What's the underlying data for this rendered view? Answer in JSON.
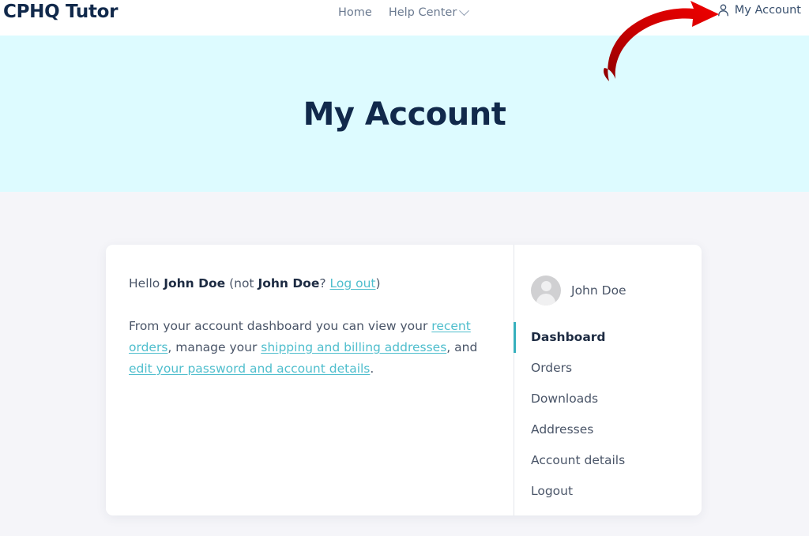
{
  "header": {
    "brand": "CPHQ Tutor",
    "nav": [
      {
        "label": "Home",
        "has_dropdown": false
      },
      {
        "label": "Help Center",
        "has_dropdown": true
      }
    ],
    "account_link": "My Account",
    "account_icon": "person-icon"
  },
  "hero": {
    "title": "My Account"
  },
  "annotation": {
    "type": "curved-arrow",
    "color": "#d40000",
    "points_to": "My Account"
  },
  "dashboard": {
    "greeting": {
      "hello": "Hello ",
      "name": "John Doe",
      "not_prefix": " (not ",
      "not_name": "John Doe",
      "question": "? ",
      "logout_link": "Log out",
      "close_paren": ")"
    },
    "intro": {
      "part1": "From your account dashboard you can view your ",
      "link1": "recent orders",
      "part2": ", manage your ",
      "link2": "shipping and billing addresses",
      "part3": ", and ",
      "link3": "edit your password and account details",
      "part4": "."
    }
  },
  "sidebar": {
    "user_name": "John Doe",
    "avatar_icon": "avatar-placeholder-icon",
    "items": [
      {
        "label": "Dashboard",
        "active": true
      },
      {
        "label": "Orders",
        "active": false
      },
      {
        "label": "Downloads",
        "active": false
      },
      {
        "label": "Addresses",
        "active": false
      },
      {
        "label": "Account details",
        "active": false
      },
      {
        "label": "Logout",
        "active": false
      }
    ]
  },
  "colors": {
    "brand_navy": "#11294b",
    "hero_bg": "#ddfbff",
    "page_bg": "#f5f5f9",
    "link_teal": "#4fbecd",
    "active_bar": "#36b0bd",
    "annotation_red": "#d40000"
  }
}
